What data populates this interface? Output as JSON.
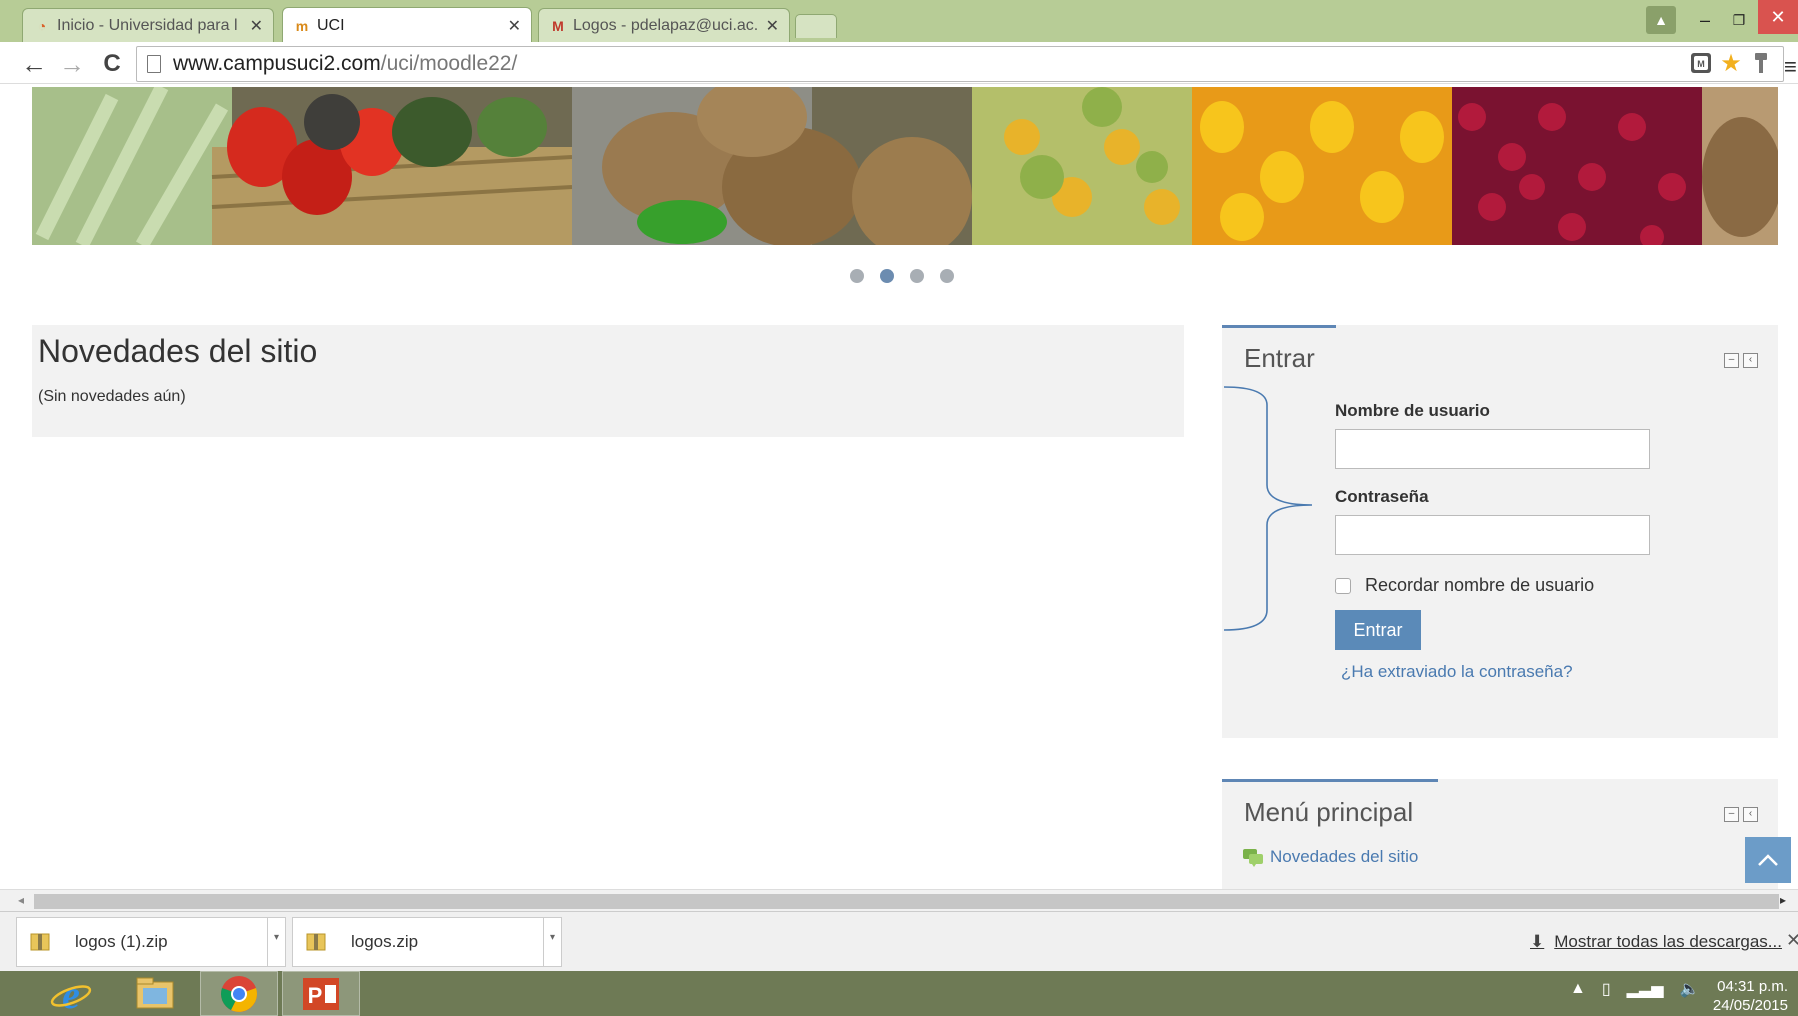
{
  "browser": {
    "tabs": [
      {
        "label": "Inicio - Universidad para l",
        "active": false
      },
      {
        "label": "UCI",
        "active": true
      },
      {
        "label": "Logos - pdelapaz@uci.ac.",
        "active": false
      }
    ],
    "url_host": "www.campusuci2.com",
    "url_path": "/uci/moodle22/"
  },
  "slider": {
    "total_dots": 4,
    "active_dot": 2
  },
  "news": {
    "title": "Novedades del sitio",
    "empty_text": "(Sin novedades aún)"
  },
  "login": {
    "title": "Entrar",
    "username_label": "Nombre de usuario",
    "password_label": "Contraseña",
    "remember_label": "Recordar nombre de usuario",
    "submit_label": "Entrar",
    "forgot_link": "¿Ha extraviado la contraseña?"
  },
  "main_menu": {
    "title": "Menú principal",
    "items": [
      {
        "label": "Novedades del sitio"
      }
    ]
  },
  "downloads": {
    "items": [
      {
        "filename": "logos (1).zip"
      },
      {
        "filename": "logos.zip"
      }
    ],
    "show_all": "Mostrar todas las descargas..."
  },
  "taskbar": {
    "time": "04:31 p.m.",
    "date": "24/05/2015"
  },
  "colors": {
    "accent": "#5b8ab8",
    "chrome_frame": "#b7cc96",
    "taskbar": "#6e7a55"
  }
}
